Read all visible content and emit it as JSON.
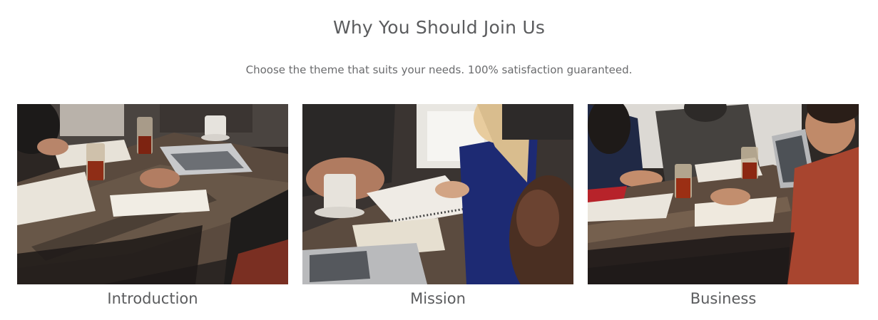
{
  "section": {
    "title": "Why You Should Join Us",
    "subtitle": "Choose the theme that suits your needs. 100% satisfaction guaranteed."
  },
  "cards": [
    {
      "title": "Introduction",
      "image": "coworking-table-photo"
    },
    {
      "title": "Mission",
      "image": "coworking-writing-photo"
    },
    {
      "title": "Business",
      "image": "coworking-meeting-photo"
    }
  ],
  "colors": {
    "heading": "#5b5c5e",
    "subtitle": "#6a6b6d",
    "background": "#ffffff"
  }
}
